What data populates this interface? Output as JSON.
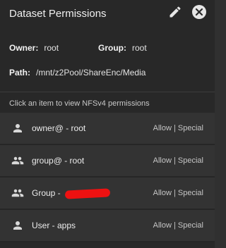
{
  "header": {
    "title": "Dataset Permissions"
  },
  "info": {
    "owner_key": "Owner:",
    "owner_value": "root",
    "group_key": "Group:",
    "group_value": "root",
    "path_key": "Path:",
    "path_value": "/mnt/z2Pool/ShareEnc/Media"
  },
  "hint": "Click an item to view NFSv4 permissions",
  "items": [
    {
      "icon": "person-icon",
      "label": "owner@ - root",
      "perm": "Allow | Special"
    },
    {
      "icon": "group-icon",
      "label": "group@ - root",
      "perm": "Allow | Special"
    },
    {
      "icon": "group-icon",
      "label": "Group - ",
      "perm": "Allow | Special"
    },
    {
      "icon": "person-icon",
      "label": "User - apps",
      "perm": "Allow | Special"
    }
  ]
}
